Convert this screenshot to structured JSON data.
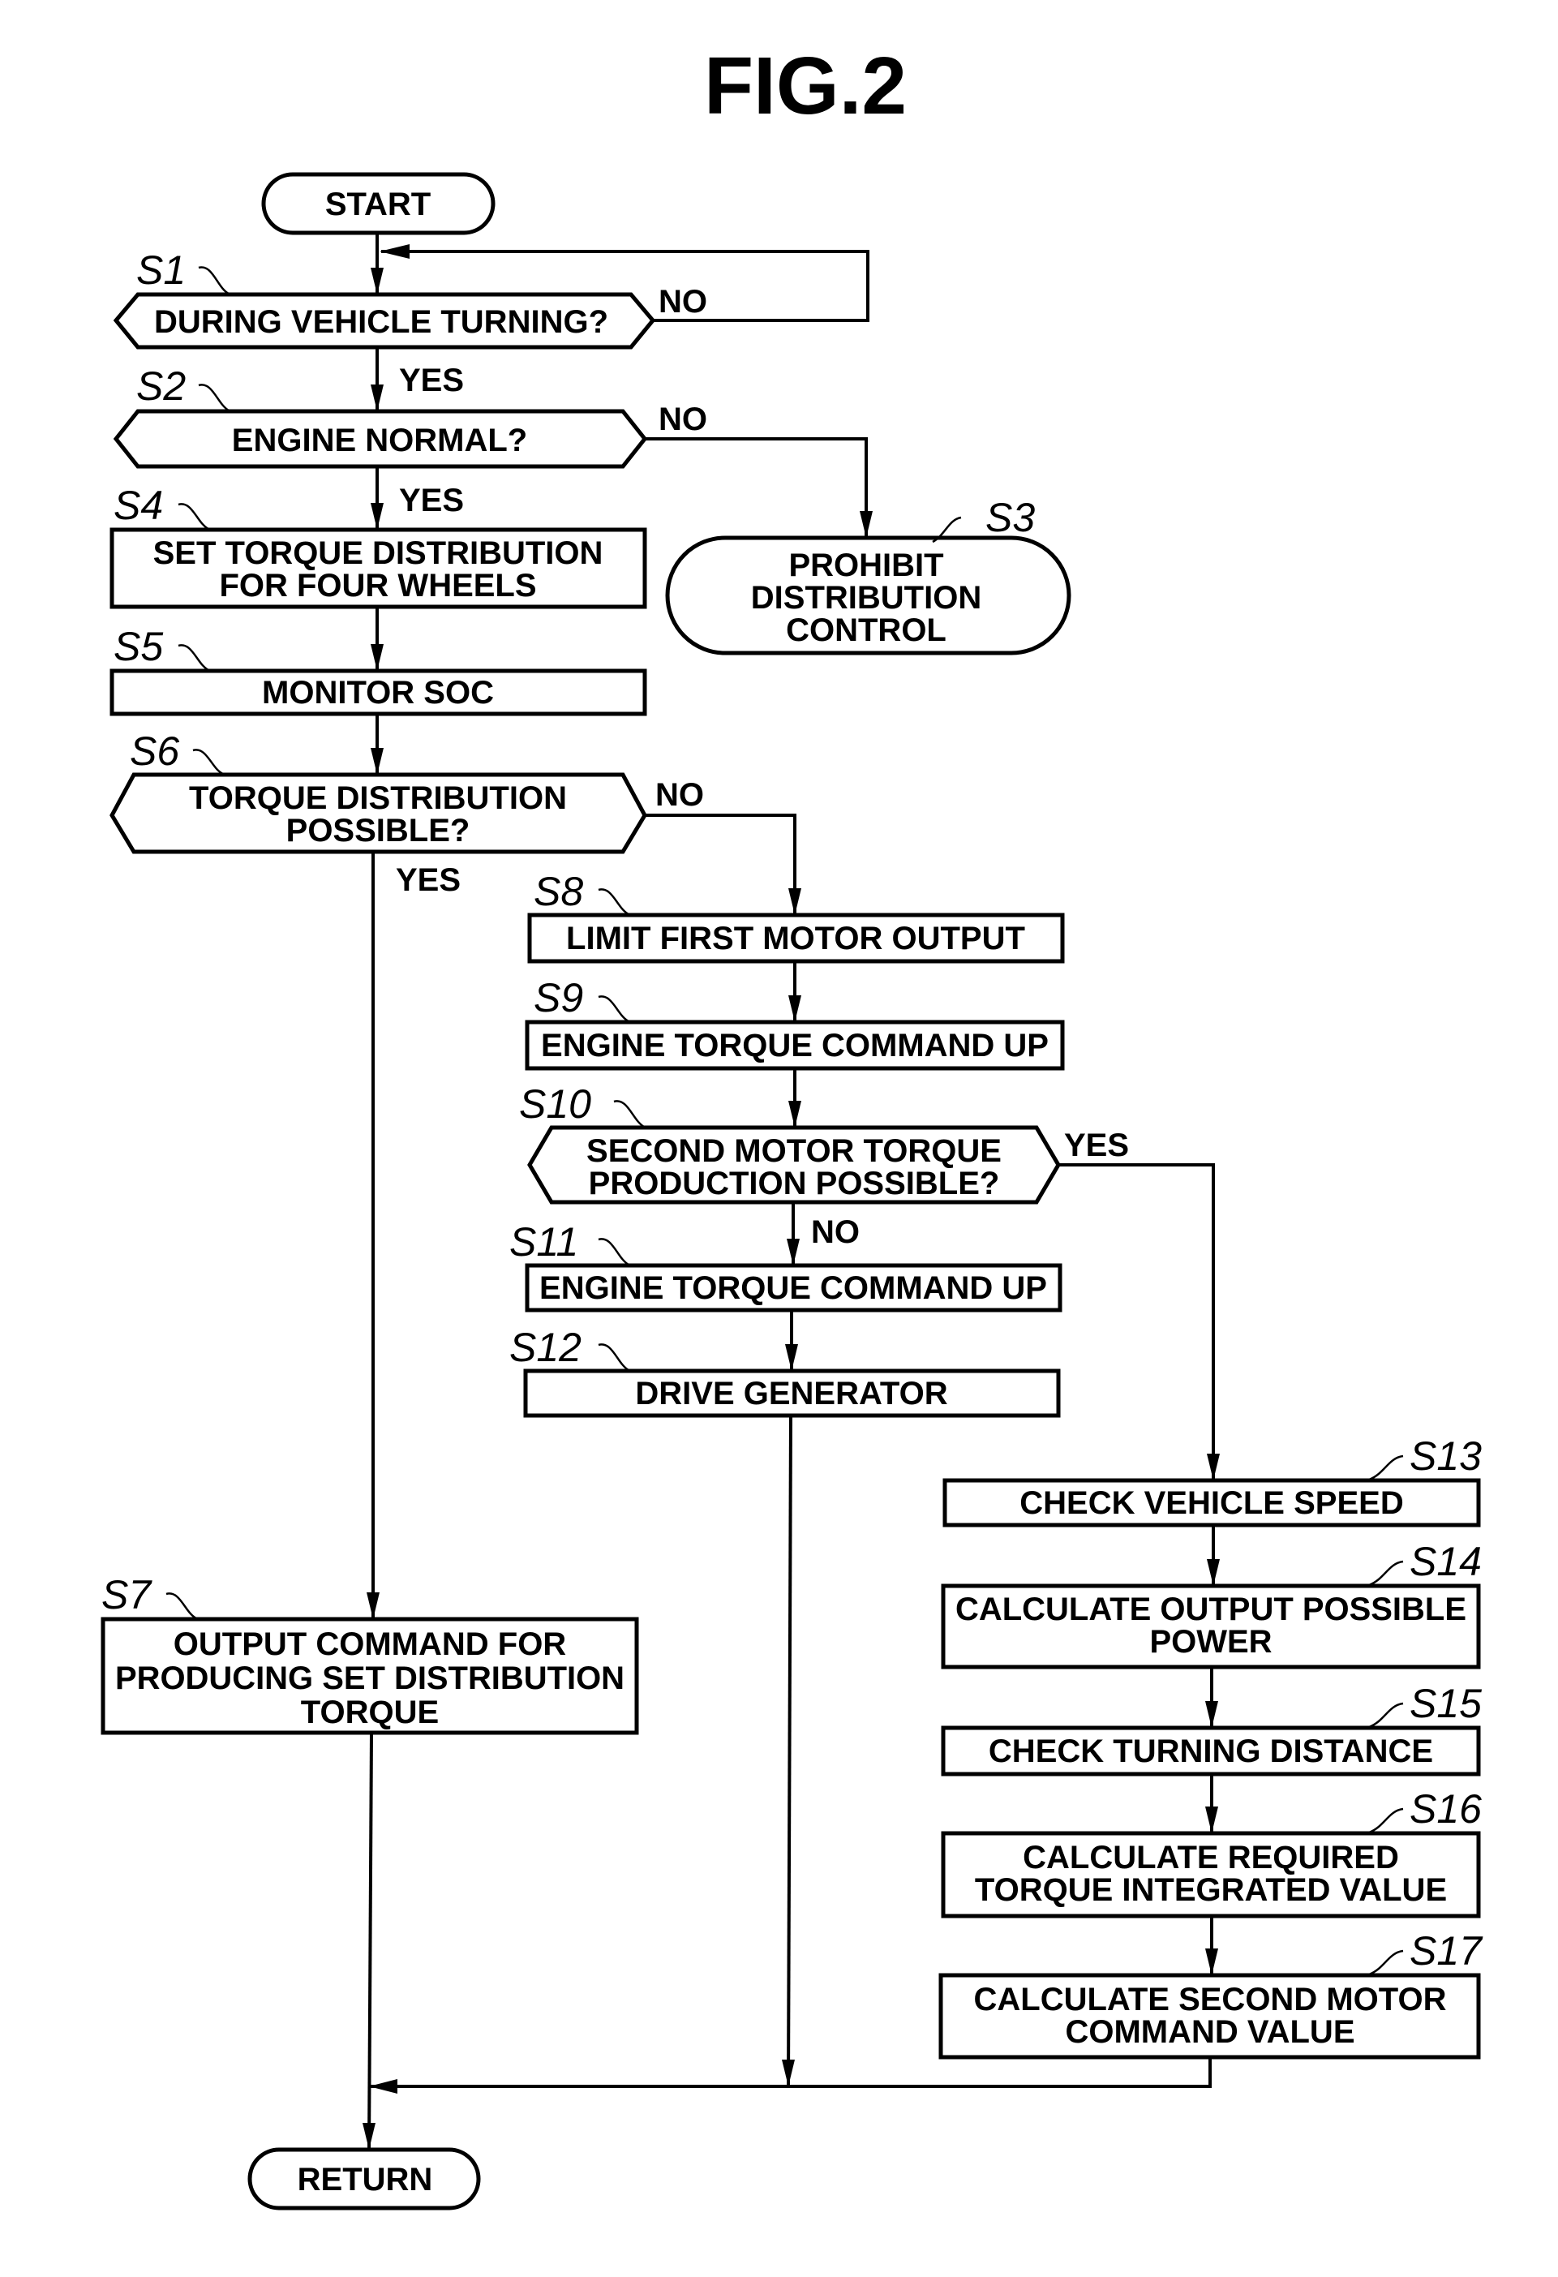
{
  "figure": {
    "title": "FIG.2"
  },
  "terminals": {
    "start": "START",
    "return": "RETURN"
  },
  "steps": {
    "S1": {
      "id": "S1",
      "type": "decision",
      "lines": [
        "DURING VEHICLE TURNING?"
      ]
    },
    "S2": {
      "id": "S2",
      "type": "decision",
      "lines": [
        "ENGINE NORMAL?"
      ]
    },
    "S3": {
      "id": "S3",
      "type": "terminal",
      "lines": [
        "PROHIBIT",
        "DISTRIBUTION",
        "CONTROL"
      ]
    },
    "S4": {
      "id": "S4",
      "type": "process",
      "lines": [
        "SET TORQUE DISTRIBUTION",
        "FOR FOUR WHEELS"
      ]
    },
    "S5": {
      "id": "S5",
      "type": "process",
      "lines": [
        "MONITOR SOC"
      ]
    },
    "S6": {
      "id": "S6",
      "type": "decision",
      "lines": [
        "TORQUE DISTRIBUTION",
        "POSSIBLE?"
      ]
    },
    "S7": {
      "id": "S7",
      "type": "process",
      "lines": [
        "OUTPUT COMMAND FOR",
        "PRODUCING SET DISTRIBUTION",
        "TORQUE"
      ]
    },
    "S8": {
      "id": "S8",
      "type": "process",
      "lines": [
        "LIMIT FIRST MOTOR OUTPUT"
      ]
    },
    "S9": {
      "id": "S9",
      "type": "process",
      "lines": [
        "ENGINE TORQUE COMMAND UP"
      ]
    },
    "S10": {
      "id": "S10",
      "type": "decision",
      "lines": [
        "SECOND MOTOR TORQUE",
        "PRODUCTION POSSIBLE?"
      ]
    },
    "S11": {
      "id": "S11",
      "type": "process",
      "lines": [
        "ENGINE TORQUE COMMAND UP"
      ]
    },
    "S12": {
      "id": "S12",
      "type": "process",
      "lines": [
        "DRIVE GENERATOR"
      ]
    },
    "S13": {
      "id": "S13",
      "type": "process",
      "lines": [
        "CHECK VEHICLE SPEED"
      ]
    },
    "S14": {
      "id": "S14",
      "type": "process",
      "lines": [
        "CALCULATE OUTPUT POSSIBLE",
        "POWER"
      ]
    },
    "S15": {
      "id": "S15",
      "type": "process",
      "lines": [
        "CHECK TURNING DISTANCE"
      ]
    },
    "S16": {
      "id": "S16",
      "type": "process",
      "lines": [
        "CALCULATE REQUIRED",
        "TORQUE INTEGRATED VALUE"
      ]
    },
    "S17": {
      "id": "S17",
      "type": "process",
      "lines": [
        "CALCULATE SECOND MOTOR",
        "COMMAND VALUE"
      ]
    }
  },
  "branch_labels": {
    "s1_no": "NO",
    "s1_yes": "YES",
    "s2_no": "NO",
    "s2_yes": "YES",
    "s6_no": "NO",
    "s6_yes": "YES",
    "s10_yes": "YES",
    "s10_no": "NO"
  }
}
